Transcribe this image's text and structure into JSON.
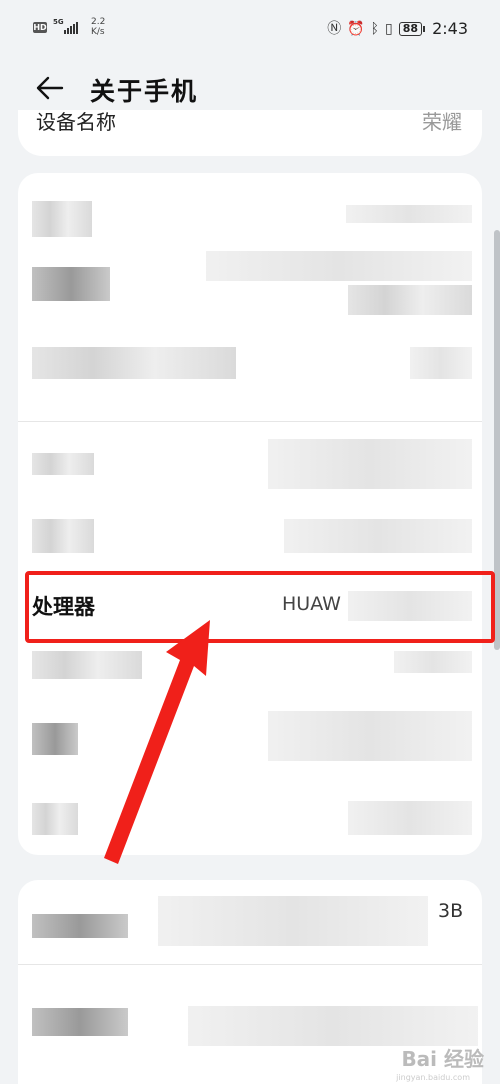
{
  "status_bar": {
    "network_speed": "2.2",
    "speed_unit": "K/s",
    "signal": "5G",
    "battery": "88",
    "time": "2:43",
    "icons": [
      "nfc-icon",
      "alarm-icon",
      "bluetooth-icon",
      "vibrate-icon"
    ]
  },
  "header": {
    "title": "关于手机",
    "back_icon": "arrow-left-icon"
  },
  "top_card": {
    "partial_label": "设备名称",
    "partial_value": "荣耀"
  },
  "processor_row": {
    "label": "处理器",
    "value": "HUAW"
  },
  "bottom_value_fragment": "3B",
  "watermark": {
    "text": "Bai 经验",
    "sub": "jingyan.baidu.com"
  },
  "colors": {
    "background": "#f1f3f5",
    "card": "#ffffff",
    "highlight": "#f0201a"
  }
}
